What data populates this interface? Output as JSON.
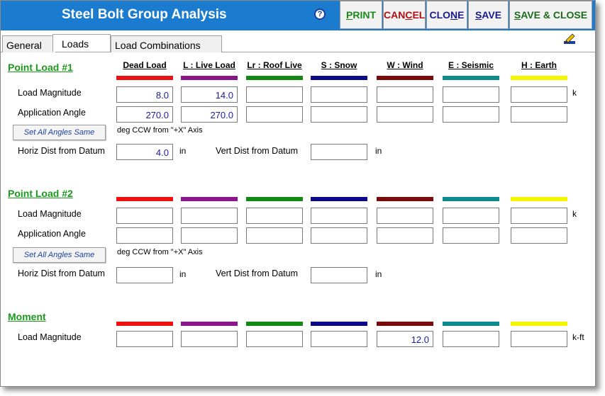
{
  "window": {
    "title": "Steel Bolt Group Analysis",
    "help_icon": "?",
    "buttons": {
      "print": {
        "pre": "",
        "u": "P",
        "post": "RINT",
        "color": "#1a8a1a"
      },
      "cancel": {
        "pre": "CAN",
        "u": "C",
        "post": "EL",
        "color": "#b01010"
      },
      "clone": {
        "pre": "CLO",
        "u": "N",
        "post": "E",
        "color": "#1a1a8a"
      },
      "save": {
        "pre": "",
        "u": "S",
        "post": "AVE",
        "color": "#1a1a8a"
      },
      "save_close": {
        "pre": "",
        "u": "S",
        "post": "AVE & CLOSE",
        "color": "#1a6a1a"
      }
    }
  },
  "tabs": [
    "General",
    "Loads",
    "Load Combinations"
  ],
  "load_columns": [
    {
      "label": "Dead Load",
      "color": "#ee1111"
    },
    {
      "label": "L : Live Load",
      "color": "#8b158b"
    },
    {
      "label": "Lr : Roof Live",
      "color": "#128a12"
    },
    {
      "label": "S : Snow",
      "color": "#0b0b88"
    },
    {
      "label": "W : Wind",
      "color": "#7a0b0b"
    },
    {
      "label": "E : Seismic",
      "color": "#0e8a8a"
    },
    {
      "label": "H : Earth",
      "color": "#f5f500"
    }
  ],
  "point_load_1": {
    "title": "Point Load #1",
    "magnitude_label": "Load Magnitude",
    "magnitude_values": [
      "8.0",
      "14.0",
      "",
      "",
      "",
      "",
      ""
    ],
    "magnitude_unit": "k",
    "angle_label": "Application Angle",
    "angle_values": [
      "270.0",
      "270.0",
      "",
      "",
      "",
      "",
      ""
    ],
    "set_angles_button": "Set All Angles Same",
    "angle_note": "deg CCW from \"+X\" Axis",
    "horiz_label": "Horiz Dist from Datum",
    "horiz_value": "4.0",
    "horiz_unit": "in",
    "vert_label": "Vert Dist from Datum",
    "vert_value": "",
    "vert_unit": "in"
  },
  "point_load_2": {
    "title": "Point Load #2",
    "magnitude_label": "Load Magnitude",
    "magnitude_values": [
      "",
      "",
      "",
      "",
      "",
      "",
      ""
    ],
    "magnitude_unit": "k",
    "angle_label": "Application Angle",
    "angle_values": [
      "",
      "",
      "",
      "",
      "",
      "",
      ""
    ],
    "set_angles_button": "Set All Angles Same",
    "angle_note": "deg CCW from \"+X\" Axis",
    "horiz_label": "Horiz Dist from Datum",
    "horiz_value": "",
    "horiz_unit": "in",
    "vert_label": "Vert Dist from Datum",
    "vert_value": "",
    "vert_unit": "in"
  },
  "moment": {
    "title": "Moment",
    "magnitude_label": "Load Magnitude",
    "magnitude_values": [
      "",
      "",
      "",
      "",
      "12.0",
      "",
      ""
    ],
    "magnitude_unit": "k-ft"
  }
}
